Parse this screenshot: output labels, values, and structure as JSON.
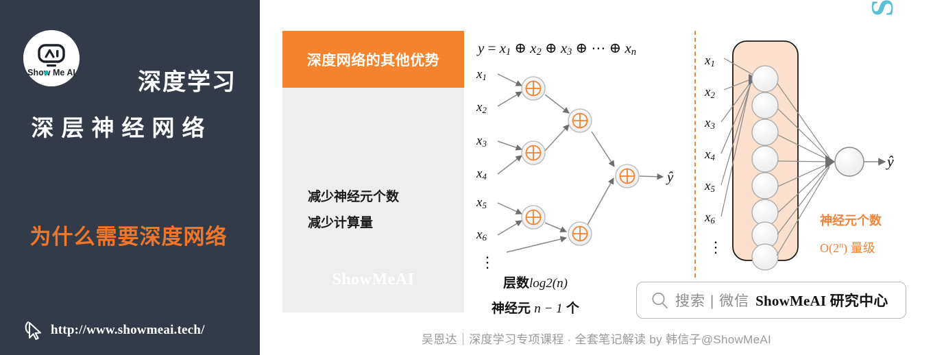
{
  "left_panel": {
    "logo_text": "Show Me AI",
    "logo_icon": "robot-ai-icon",
    "title": "深度学习",
    "subtitle": "深层神经网络",
    "headline": "为什么需要深度网络",
    "url": "http://www.showmeai.tech/",
    "cursor_icon": "cursor-pointer-icon",
    "bg_color": "#333b48",
    "accent_color": "#f2762a"
  },
  "card": {
    "header": "深度网络的其他优势",
    "header_bg": "#f5822c",
    "body_lines": [
      "减少神经元个数",
      "减少计算量"
    ],
    "watermark": "ShowMeAI"
  },
  "xor_diagram": {
    "formula": {
      "lhs": "y",
      "eq": "=",
      "terms": [
        "x",
        "x",
        "x",
        "x"
      ],
      "subs": [
        "1",
        "2",
        "3",
        "n"
      ],
      "op": "⊕",
      "ellipsis": "⋯"
    },
    "input_labels": [
      "x",
      "x",
      "x",
      "x",
      "x",
      "x"
    ],
    "input_subs": [
      "1",
      "2",
      "3",
      "4",
      "5",
      "6"
    ],
    "vdots": "⋮",
    "node_glyph": "⊕",
    "output_label": "ŷ",
    "captions": [
      {
        "text": "层数",
        "math": "log2(n)"
      },
      {
        "text": "神经元 ",
        "math": "n − 1",
        "tail": " 个"
      }
    ],
    "node_color": "#f5822c"
  },
  "nn_diagram": {
    "input_labels": [
      "x",
      "x",
      "x",
      "x",
      "x",
      "x"
    ],
    "input_subs": [
      "1",
      "2",
      "3",
      "4",
      "5",
      "6"
    ],
    "vdots": "⋮",
    "hidden_units": 8,
    "output_label": "ŷ",
    "labels": [
      {
        "text": "神经元个数"
      },
      {
        "text": "O(2",
        "sup": "n",
        "tail": ") 量级"
      }
    ],
    "box_color": "#fae0cd",
    "accent_color": "#f0853a",
    "watermark": "ShowMeAI"
  },
  "search_pill": {
    "icon": "search-icon",
    "placeholder": "搜索 | 微信",
    "brand": "ShowMeAI 研究中心"
  },
  "footer": {
    "text": "吴恩达｜深度学习专项课程 · 全套笔记解读 by 韩信子@ShowMeAI"
  }
}
